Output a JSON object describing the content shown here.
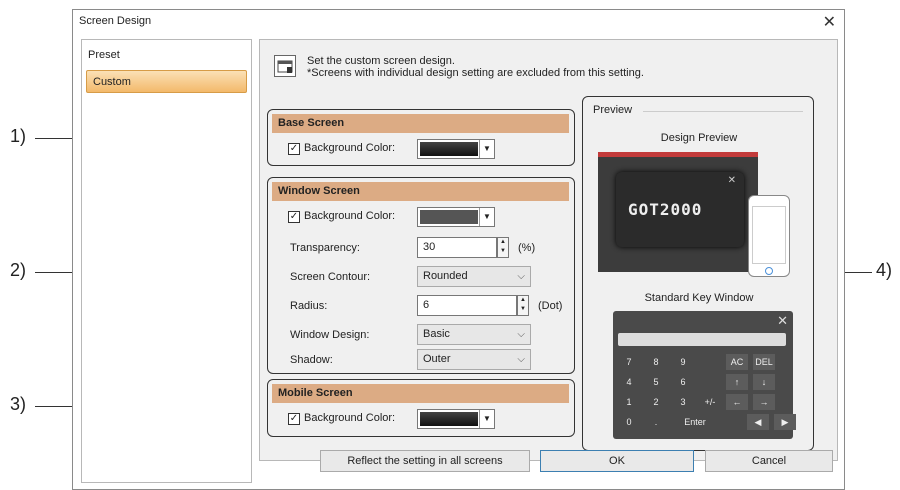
{
  "dialog": {
    "title": "Screen Design",
    "close": "✕"
  },
  "sidebar": {
    "items": [
      {
        "label": "Preset"
      },
      {
        "label": "Custom"
      }
    ]
  },
  "info": {
    "line1": "Set the custom screen design.",
    "line2": "*Screens with individual design setting are excluded from this setting."
  },
  "base": {
    "title": "Base Screen",
    "bg_label": "Background Color:",
    "checked": "✓"
  },
  "window": {
    "title": "Window Screen",
    "bg_label": "Background Color:",
    "checked": "✓",
    "transparency_label": "Transparency:",
    "transparency_value": "30",
    "transparency_unit": "(%)",
    "contour_label": "Screen Contour:",
    "contour_value": "Rounded",
    "radius_label": "Radius:",
    "radius_value": "6",
    "radius_unit": "(Dot)",
    "design_label": "Window Design:",
    "design_value": "Basic",
    "shadow_label": "Shadow:",
    "shadow_value": "Outer"
  },
  "mobile": {
    "title": "Mobile Screen",
    "bg_label": "Background Color:",
    "checked": "✓"
  },
  "preview": {
    "group_label": "Preview",
    "design_preview": "Design Preview",
    "logo": "GOT2000",
    "key_window": "Standard Key Window",
    "keys": [
      [
        "7",
        "8",
        "9",
        "",
        "AC",
        "DEL"
      ],
      [
        "4",
        "5",
        "6",
        "",
        "↑",
        "↓"
      ],
      [
        "1",
        "2",
        "3",
        "+/-",
        "←",
        "→"
      ],
      [
        "0",
        ".",
        "Enter",
        "",
        "◀",
        "▶"
      ]
    ]
  },
  "buttons": {
    "reflect": "Reflect the setting in all screens",
    "ok": "OK",
    "cancel": "Cancel"
  },
  "callouts": [
    "1)",
    "2)",
    "3)",
    "4)"
  ],
  "colors": {
    "header": "#dcab84",
    "accent": "#f3b96b"
  }
}
